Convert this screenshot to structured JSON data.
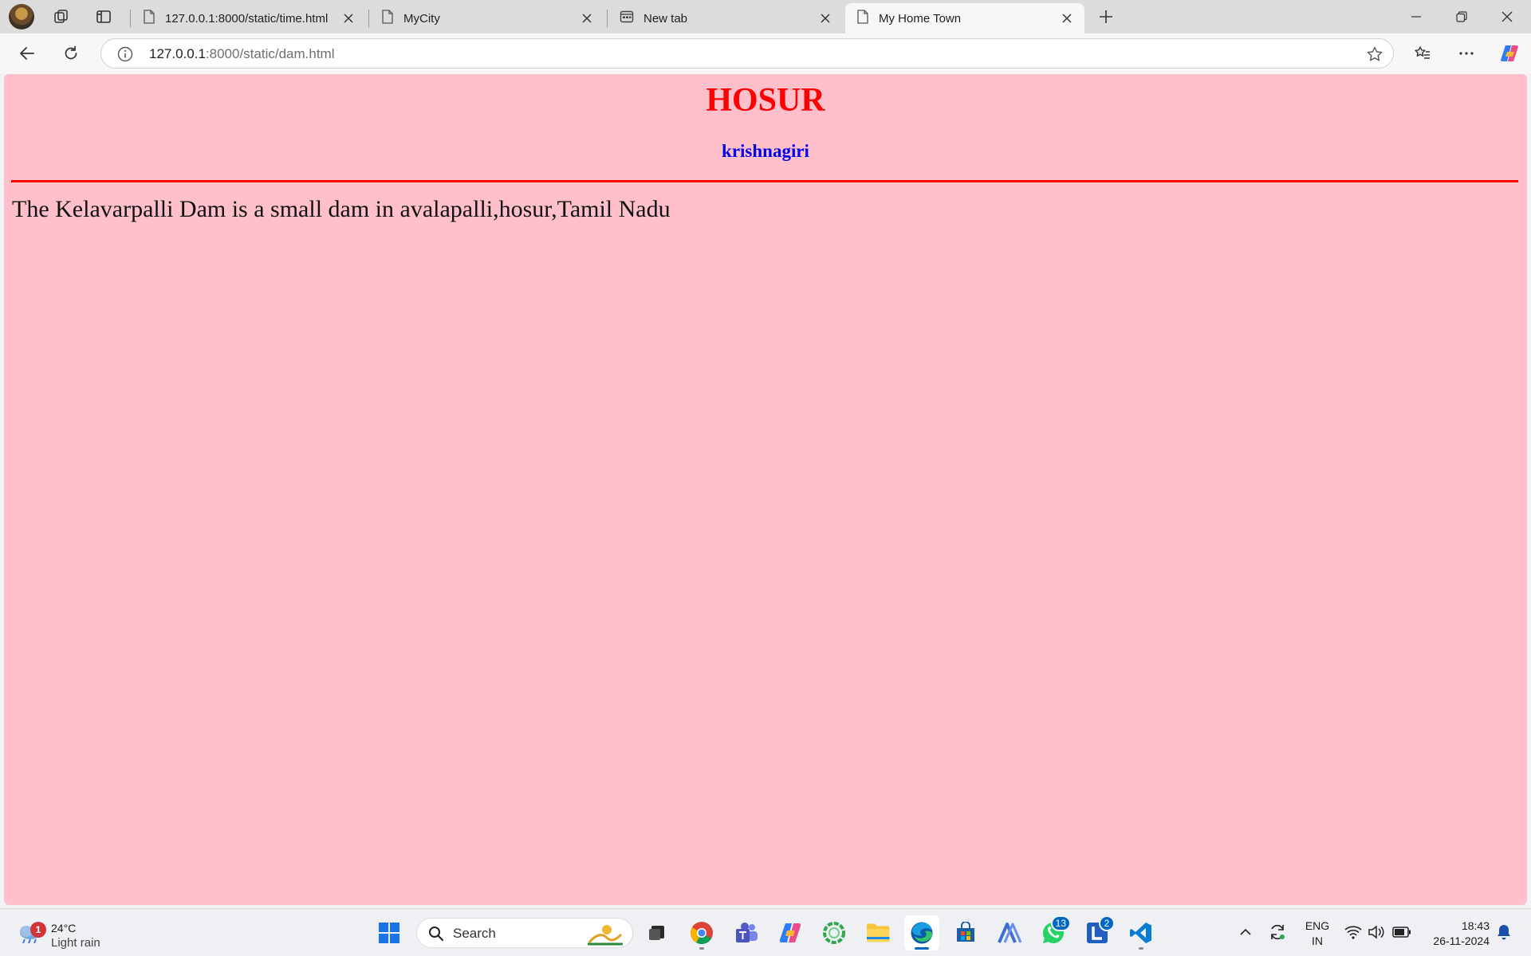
{
  "browser": {
    "tabs": [
      {
        "title": "127.0.0.1:8000/static/time.html",
        "icon": "page-icon"
      },
      {
        "title": "MyCity",
        "icon": "page-icon"
      },
      {
        "title": "New tab",
        "icon": "new-tab-icon"
      },
      {
        "title": "My Home Town",
        "icon": "page-icon",
        "active": true
      }
    ],
    "address": {
      "host": "127.0.0.1",
      "path": ":8000/static/dam.html"
    }
  },
  "page": {
    "heading": "HOSUR",
    "subheading": "krishnagiri",
    "paragraph": "The Kelavarpalli Dam is a small dam in avalapalli,hosur,Tamil Nadu",
    "background_color": "#ffc0cb",
    "heading_color": "#ff0000",
    "subheading_color": "#0000ee",
    "rule_color": "#ff0000"
  },
  "taskbar": {
    "weather": {
      "temp": "24°C",
      "desc": "Light rain",
      "badge": "1"
    },
    "search_placeholder": "Search",
    "apps": [
      {
        "name": "start-icon"
      },
      {
        "name": "task-view-icon"
      },
      {
        "name": "chrome-icon"
      },
      {
        "name": "teams-icon"
      },
      {
        "name": "copilot-icon"
      },
      {
        "name": "green-circle-app-icon"
      },
      {
        "name": "file-explorer-icon"
      },
      {
        "name": "edge-icon",
        "active": true
      },
      {
        "name": "store-icon"
      },
      {
        "name": "arc-app-icon"
      },
      {
        "name": "whatsapp-icon",
        "badge": "13"
      },
      {
        "name": "l-app-icon",
        "badge": "2"
      },
      {
        "name": "vscode-icon"
      }
    ],
    "tray": {
      "lang_line1": "ENG",
      "lang_line2": "IN",
      "time": "18:43",
      "date": "26-11-2024"
    }
  }
}
